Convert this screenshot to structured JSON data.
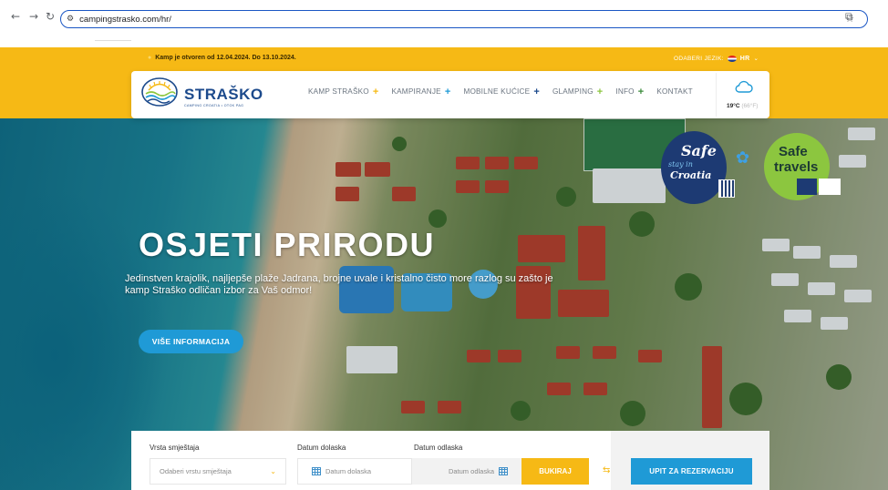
{
  "browser": {
    "url": "campingstrasko.com/hr/"
  },
  "topbar": {
    "notice": "Kamp je otvoren od 12.04.2024. Do 13.10.2024.",
    "lang_label": "ODABERI JEZIK:",
    "lang_code": "HR"
  },
  "header": {
    "logo_name": "STRAŠKO",
    "logo_sub": "CAMPING CROATIA • OTOK PAG",
    "menu": [
      {
        "label": "KAMP STRAŠKO",
        "plus": "+",
        "color": "#f6b915"
      },
      {
        "label": "KAMPIRANJE",
        "plus": "+",
        "color": "#1f9ad6"
      },
      {
        "label": "MOBILNE KUĆICE",
        "plus": "+",
        "color": "#1c4a8c"
      },
      {
        "label": "GLAMPING",
        "plus": "+",
        "color": "#8cc63f"
      },
      {
        "label": "INFO",
        "plus": "+",
        "color": "#3a8b3a"
      },
      {
        "label": "KONTAKT",
        "plus": "",
        "color": ""
      }
    ],
    "weather": {
      "temp_c": "19°C",
      "temp_f": "(66°F)"
    }
  },
  "badges": {
    "safe_croatia": {
      "line1": "Safe",
      "line2": "stay in",
      "line3": "Croatia"
    },
    "safe_travels": {
      "line1": "Safe",
      "line2": "travels"
    }
  },
  "hero": {
    "title": "OSJETI PRIRODU",
    "subtitle": "Jedinstven krajolik, najljepše plaže Jadrana, brojne uvale i kristalno čisto more razlog su zašto je kamp Straško odličan izbor za Vaš odmor!",
    "cta": "VIŠE INFORMACIJA"
  },
  "booking": {
    "type_label": "Vrsta smještaja",
    "type_placeholder": "Odaberi vrstu smještaja",
    "arrival_label": "Datum dolaska",
    "arrival_placeholder": "Datum dolaska",
    "departure_label": "Datum odlaska",
    "departure_placeholder": "Datum odlaska",
    "book_button": "BUKIRAJ",
    "inquiry_button": "UPIT ZA REZERVACIJU"
  },
  "colors": {
    "brand_yellow": "#f6b915",
    "brand_blue": "#1f9ad6",
    "logo_blue": "#1c4a8c"
  }
}
